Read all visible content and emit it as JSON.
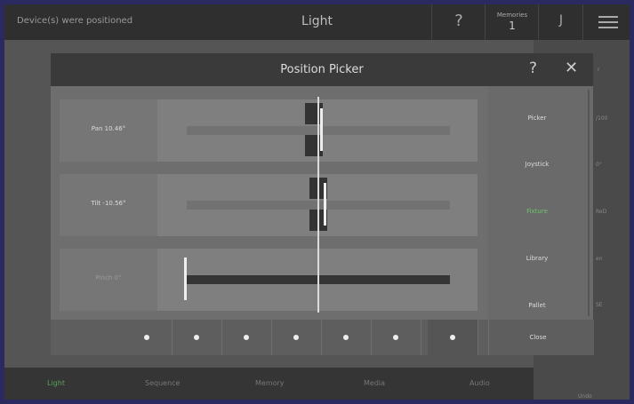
{
  "header": {
    "status": "Device(s) were positioned",
    "title": "Light",
    "help_glyph": "?",
    "memories_label": "Memories",
    "memories_value": "1",
    "j_glyph": "J",
    "menu_icon": "hamburger-menu-icon"
  },
  "background_panel": {
    "labels": [
      "r",
      "/100",
      "0°",
      "ReD",
      "en",
      "SE",
      "Undo"
    ]
  },
  "bottom_tabs": [
    {
      "label": "Light",
      "active": true
    },
    {
      "label": "Sequence",
      "active": false
    },
    {
      "label": "Memory",
      "active": false
    },
    {
      "label": "Media",
      "active": false
    },
    {
      "label": "Audio",
      "active": false
    }
  ],
  "dialog": {
    "title": "Position Picker",
    "help_glyph": "?",
    "close_glyph": "✕",
    "rows": [
      {
        "label": "Pan 10.46°",
        "enabled": true
      },
      {
        "label": "Tilt -10.56°",
        "enabled": true
      },
      {
        "label": "Pinch 0°",
        "enabled": false
      }
    ],
    "side_items": [
      {
        "label": "Picker",
        "active": false
      },
      {
        "label": "Joystick",
        "active": false
      },
      {
        "label": "Fixture",
        "active": true
      },
      {
        "label": "Library",
        "active": false
      },
      {
        "label": "Pallet",
        "active": false
      }
    ],
    "dots_count": 7,
    "close_label": "Close"
  },
  "colors": {
    "accent_active": "#6ec46e",
    "frame_border": "#2a2a60"
  }
}
